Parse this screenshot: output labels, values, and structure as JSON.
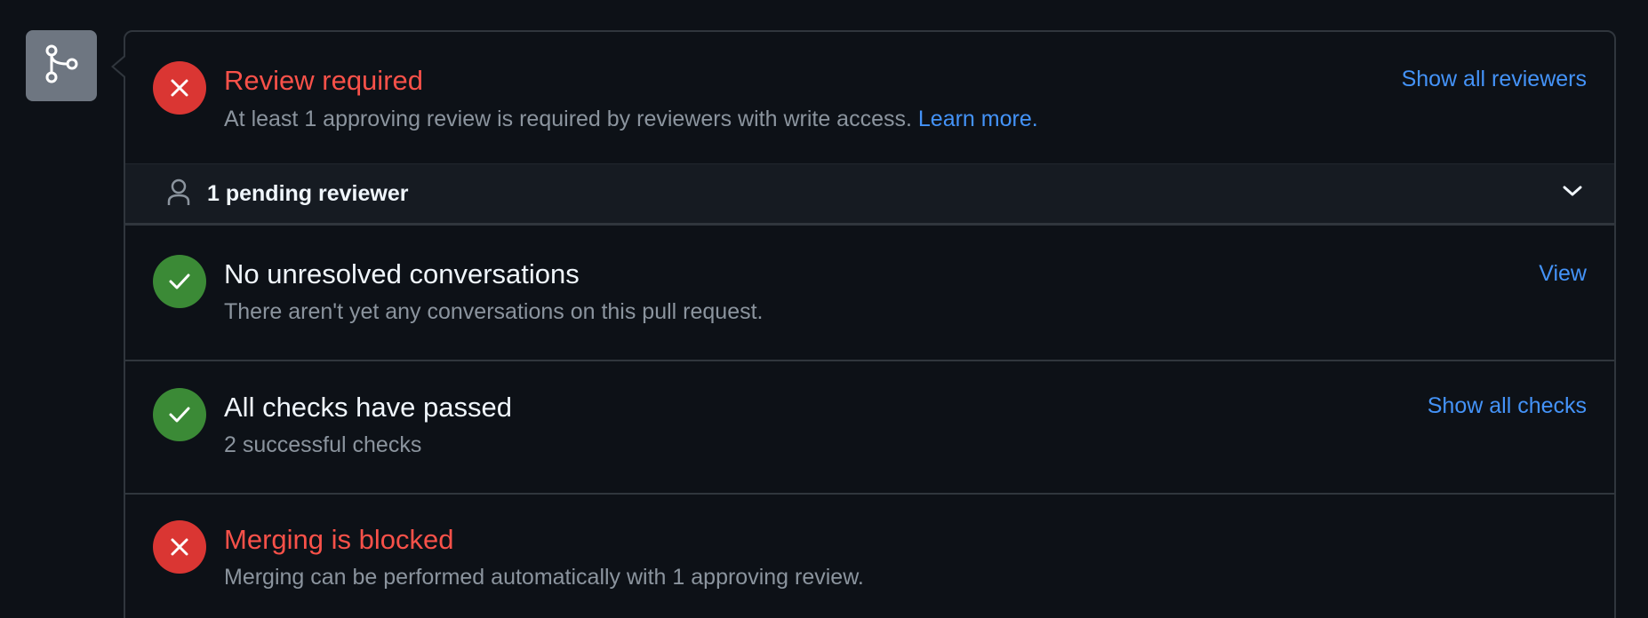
{
  "sidebar": {
    "icon": "git-branch-icon"
  },
  "review": {
    "title": "Review required",
    "description": "At least 1 approving review is required by reviewers with write access.",
    "learn_more": "Learn more.",
    "action": "Show all reviewers",
    "status_icon": "x-icon",
    "color": "#f85149"
  },
  "reviewers": {
    "label": "1 pending reviewer",
    "icon": "person-icon",
    "toggle_icon": "chevron-down-icon"
  },
  "conversations": {
    "title": "No unresolved conversations",
    "description": "There aren't yet any conversations on this pull request.",
    "action": "View",
    "status_icon": "check-icon",
    "color": "#3b8a36"
  },
  "checks": {
    "title": "All checks have passed",
    "description": "2 successful checks",
    "action": "Show all checks",
    "status_icon": "check-icon",
    "color": "#3b8a36"
  },
  "merge": {
    "title": "Merging is blocked",
    "description": "Merging can be performed automatically with 1 approving review.",
    "status_icon": "x-icon",
    "color": "#da3633"
  },
  "theme": {
    "background": "#0d1117",
    "border": "#30363d",
    "link": "#4493f8",
    "muted_text": "#8b949e"
  }
}
